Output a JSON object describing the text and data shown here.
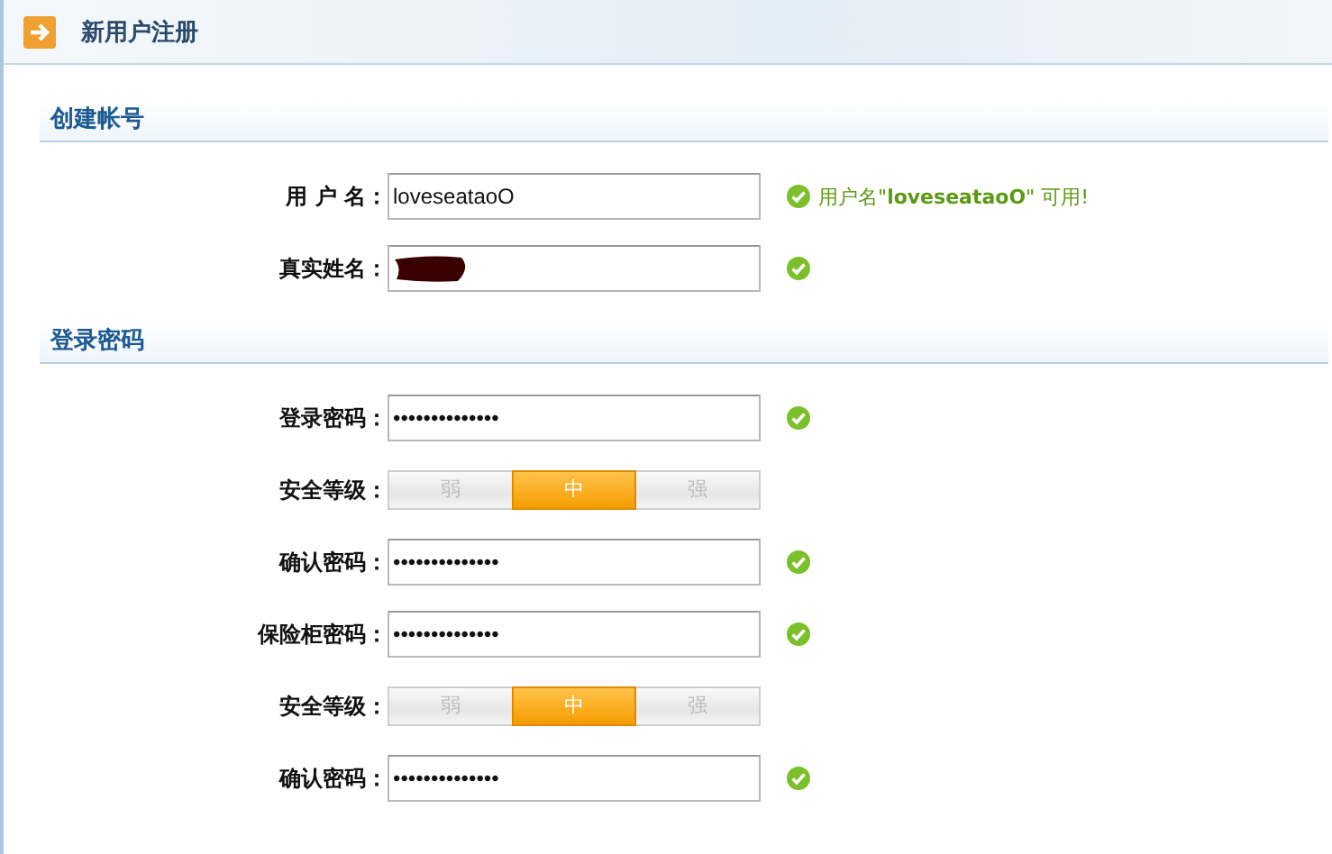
{
  "header": {
    "title": "新用户注册"
  },
  "sections": [
    {
      "heading": "创建帐号",
      "rows": [
        {
          "kind": "field",
          "label": "用 户 名：",
          "value": "loveseataoO",
          "valid": true,
          "message": "用户名\"**loveseataoO**\" 可用!"
        },
        {
          "kind": "field",
          "label": "真实姓名：",
          "redacted": true,
          "valid": true
        }
      ]
    },
    {
      "heading": "登录密码",
      "rows": [
        {
          "kind": "field",
          "label": "登录密码：",
          "value": "••••••••••••••",
          "valid": true
        },
        {
          "kind": "strength",
          "label": "安全等级：",
          "levels": [
            {
              "label": "弱",
              "selected": false
            },
            {
              "label": "中",
              "selected": true
            },
            {
              "label": "强",
              "selected": false
            }
          ]
        },
        {
          "kind": "field",
          "label": "确认密码：",
          "value": "••••••••••••••",
          "valid": true
        },
        {
          "kind": "field",
          "label": "保险柜密码：",
          "value": "••••••••••••••",
          "valid": true
        },
        {
          "kind": "strength",
          "label": "安全等级：",
          "levels": [
            {
              "label": "弱",
              "selected": false
            },
            {
              "label": "中",
              "selected": true
            },
            {
              "label": "强",
              "selected": false
            }
          ]
        },
        {
          "kind": "field",
          "label": "确认密码：",
          "value": "••••••••••••••",
          "valid": true
        }
      ]
    }
  ]
}
